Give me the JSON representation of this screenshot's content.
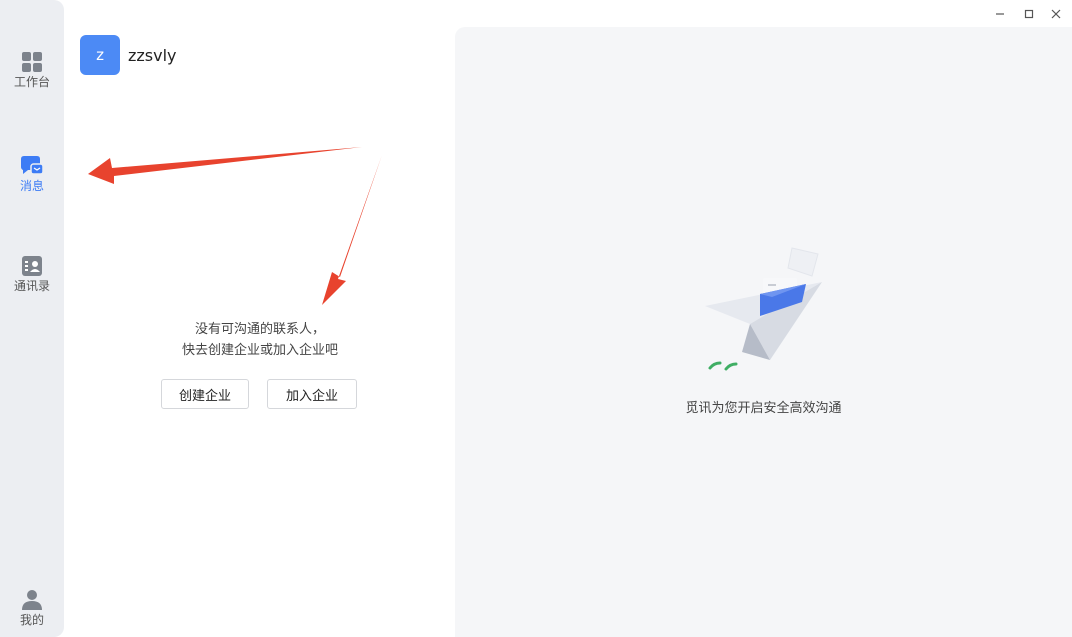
{
  "sidebar": {
    "items": [
      {
        "label": "工作台",
        "icon": "grid-icon",
        "active": false
      },
      {
        "label": "消息",
        "icon": "chat-icon",
        "active": true
      },
      {
        "label": "通讯录",
        "icon": "contacts-icon",
        "active": false
      }
    ],
    "profile": {
      "label": "我的",
      "icon": "user-icon"
    }
  },
  "window_controls": [
    "minimize-icon",
    "maximize-icon",
    "close-icon"
  ],
  "user": {
    "avatar_letter": "z",
    "name": "zzsvly"
  },
  "empty_state": {
    "line1": "没有可沟通的联系人，",
    "line2": "快去创建企业或加入企业吧",
    "create_button": "创建企业",
    "join_button": "加入企业"
  },
  "welcome": {
    "tagline": "觅讯为您开启安全高效沟通"
  },
  "colors": {
    "accent": "#3d7cf5",
    "sidebar_bg": "#eceef2",
    "panel_bg": "#f5f6f8",
    "annotation_arrow": "#e8432e"
  }
}
